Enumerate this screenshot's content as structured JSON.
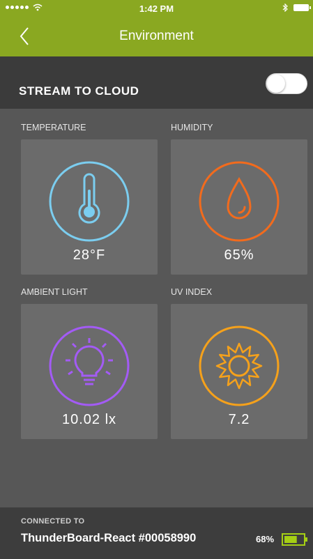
{
  "status_bar": {
    "time": "1:42 PM"
  },
  "nav": {
    "title": "Environment"
  },
  "stream": {
    "label": "STREAM TO CLOUD",
    "enabled": false
  },
  "sensors": [
    {
      "label": "TEMPERATURE",
      "value": "28°F",
      "icon": "thermometer-icon",
      "color": "#7bcdef"
    },
    {
      "label": "HUMIDITY",
      "value": "65%",
      "icon": "droplet-icon",
      "color": "#f26b1d"
    },
    {
      "label": "AMBIENT LIGHT",
      "value": "10.02 lx",
      "icon": "lightbulb-icon",
      "color": "#a35bf5"
    },
    {
      "label": "UV INDEX",
      "value": "7.2",
      "icon": "sun-icon",
      "color": "#f5a11b"
    }
  ],
  "footer": {
    "caption": "CONNECTED TO",
    "device_name": "ThunderBoard-React #00058990",
    "battery_percent": "68%",
    "battery_level": 0.68
  },
  "colors": {
    "accent": "#8aa821",
    "background": "#575757",
    "tile": "#6b6b6b"
  }
}
